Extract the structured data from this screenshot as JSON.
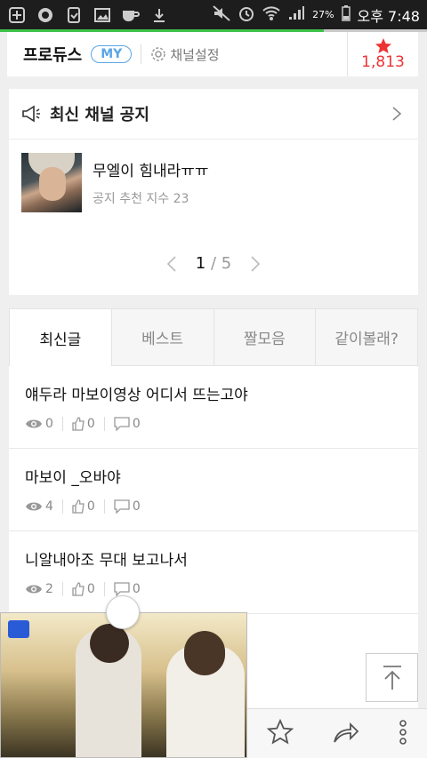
{
  "status_bar": {
    "battery": "27%",
    "time": "오후 7:48"
  },
  "header": {
    "channel_name": "프로듀스",
    "my_badge": "MY",
    "settings_label": "채널설정",
    "favorite_count": "1,813"
  },
  "notice": {
    "title": "최신 채널 공지",
    "item": {
      "title": "무엘이 힘내라ㅠㅠ",
      "subtitle": "공지 추천 지수 23"
    },
    "pager": {
      "current": "1",
      "separator": "/",
      "total": "5"
    }
  },
  "tabs": [
    {
      "label": "최신글"
    },
    {
      "label": "베스트"
    },
    {
      "label": "짤모음"
    },
    {
      "label": "같이볼래?"
    }
  ],
  "posts": [
    {
      "title": "얘두라 마보이영상 어디서 뜨는고야",
      "views": "0",
      "likes": "0",
      "comments": "0"
    },
    {
      "title": "마보이 _오바야",
      "views": "4",
      "likes": "0",
      "comments": "0"
    },
    {
      "title": "니알내아조 무대 보고나서",
      "views": "2",
      "likes": "0",
      "comments": "0"
    }
  ],
  "colors": {
    "accent_green": "#3ec14a",
    "badge_blue": "#5aa6e6",
    "favorite_red": "#e33333"
  }
}
